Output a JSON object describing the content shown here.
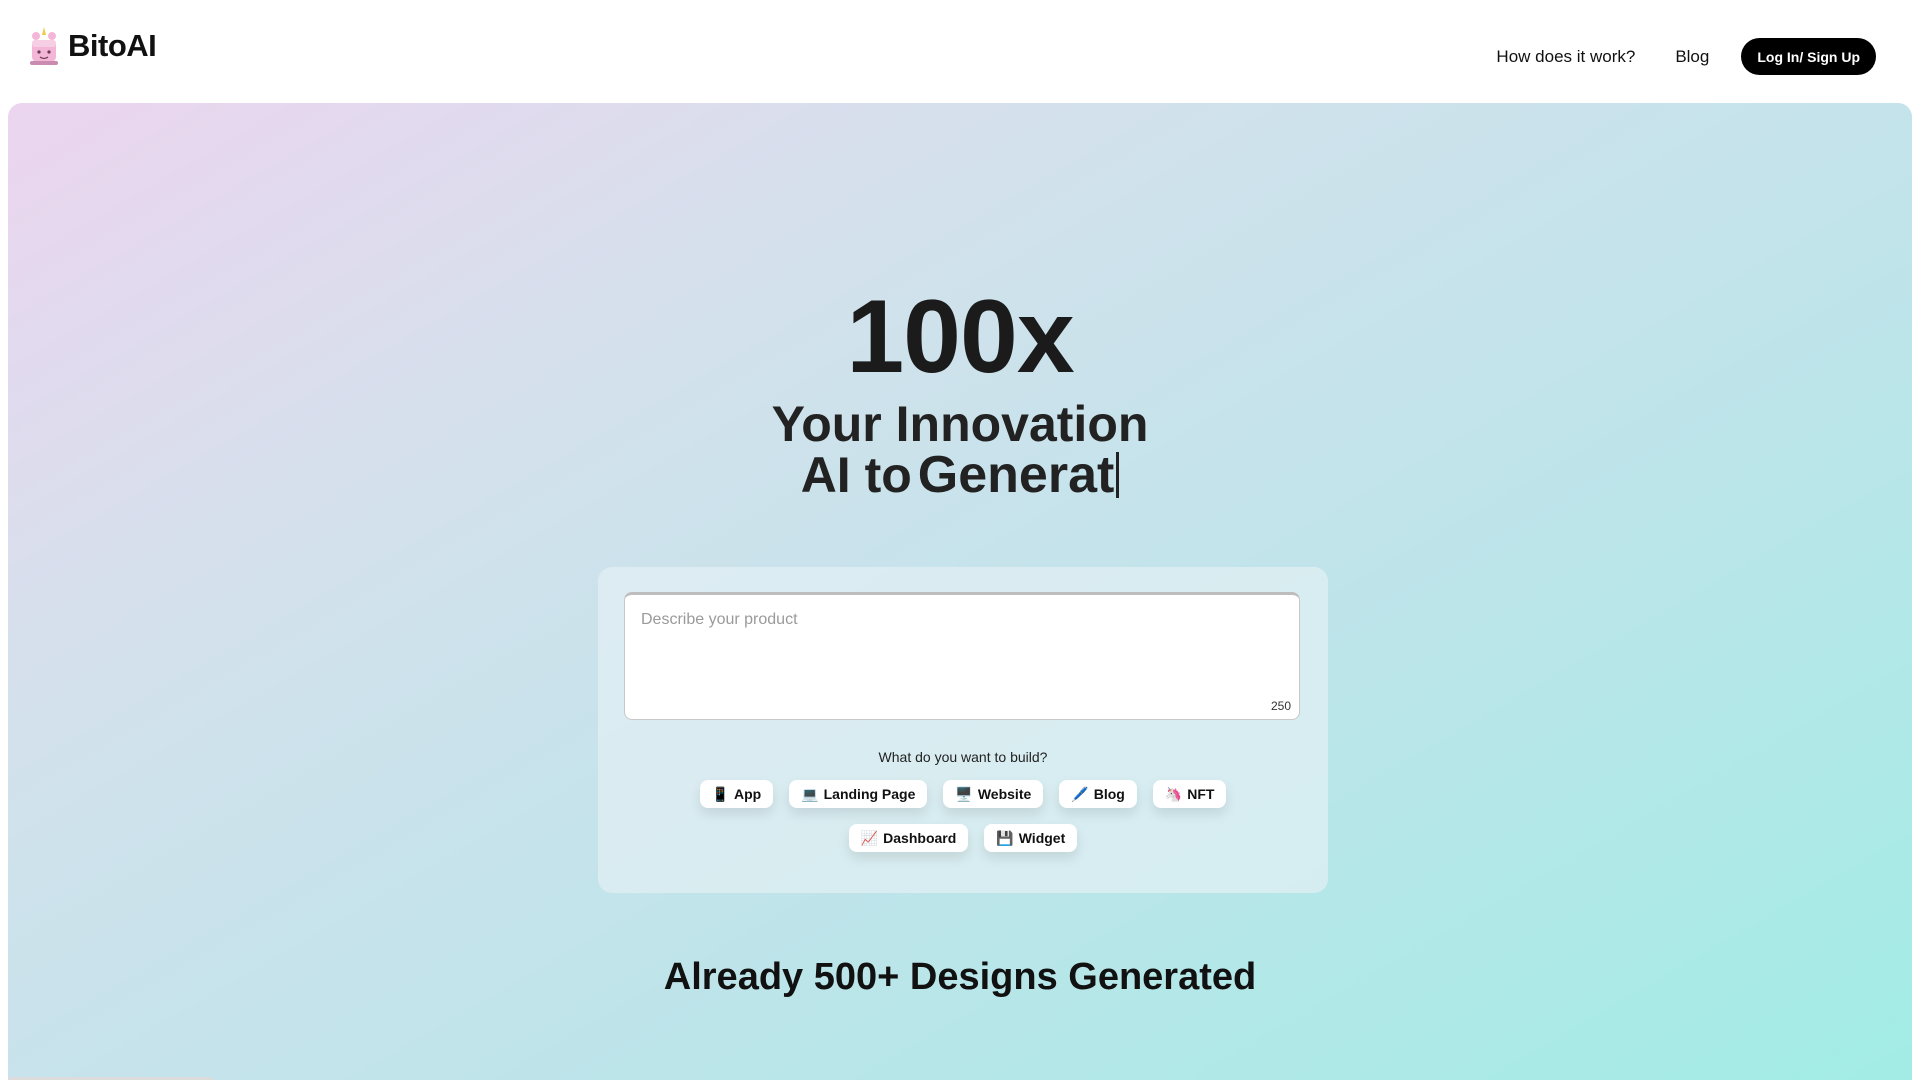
{
  "header": {
    "brand": "BitoAI",
    "logo_icon": "unicorn-cake-icon",
    "nav": {
      "how": "How does it work?",
      "blog": "Blog"
    },
    "login_label": "Log In/ Sign Up"
  },
  "hero": {
    "big": "100x",
    "line1": "Your Innovation",
    "line2_prefix": "AI to",
    "line2_typed": "Generat",
    "input_placeholder": "Describe your product",
    "char_limit": "250",
    "question": "What do you want to build?",
    "chips": [
      {
        "icon": "📱",
        "label": "App"
      },
      {
        "icon": "💻",
        "label": "Landing Page"
      },
      {
        "icon": "🖥️",
        "label": "Website"
      },
      {
        "icon": "🖊️",
        "label": "Blog"
      },
      {
        "icon": "🦄",
        "label": "NFT"
      },
      {
        "icon": "📈",
        "label": "Dashboard"
      },
      {
        "icon": "💾",
        "label": "Widget"
      }
    ],
    "already": "Already 500+ Designs Generated"
  },
  "colors": {
    "gradient_start": "#ecd5ef",
    "gradient_end": "#a2ece5",
    "button_bg": "#000000"
  }
}
